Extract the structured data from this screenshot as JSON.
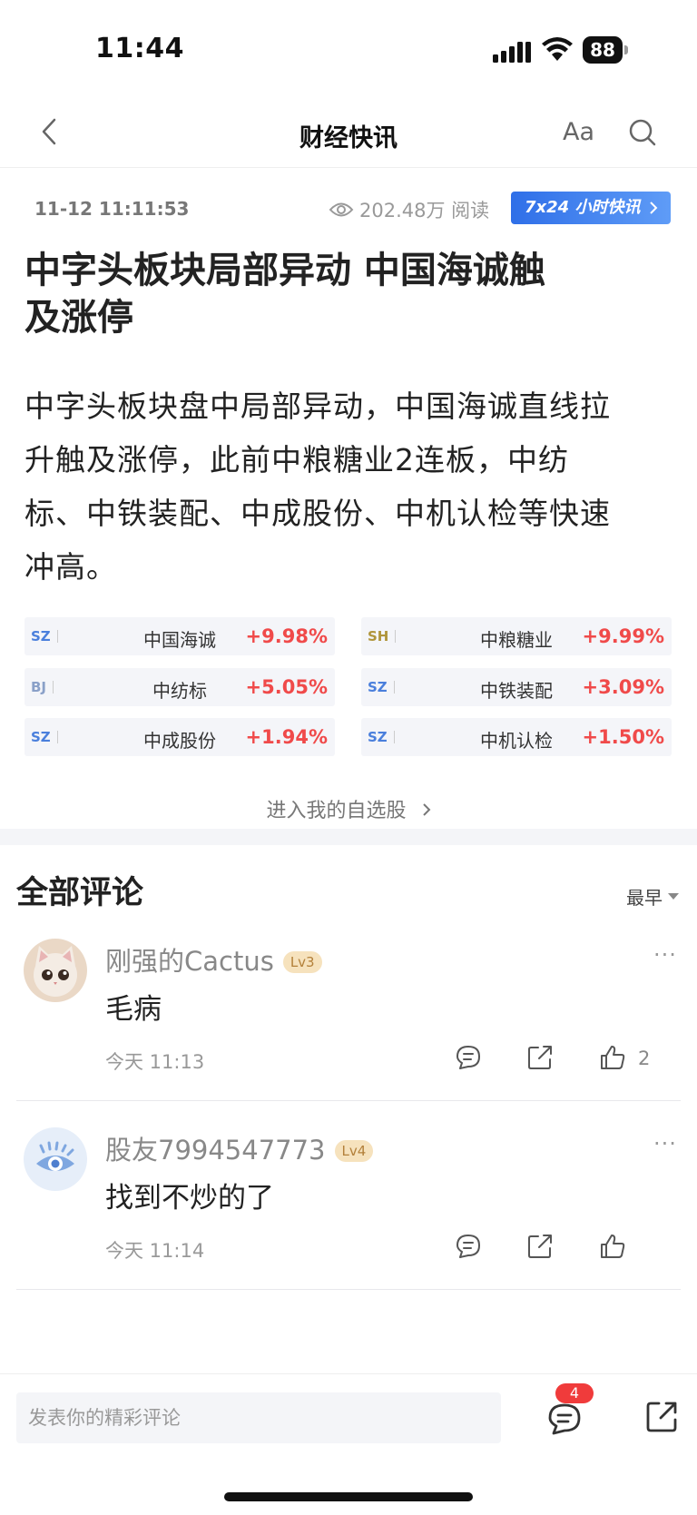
{
  "status_bar": {
    "time": "11:44",
    "battery": "88"
  },
  "nav": {
    "title": "财经快讯",
    "font_label": "Aa"
  },
  "article": {
    "datetime": "11-12 11:11:53",
    "views": "202.48万 阅读",
    "badge": "7x24 小时快讯",
    "headline_line1": "中字头板块局部异动 中国海诚触",
    "headline_line2": "及涨停",
    "body_lines": [
      "中字头板块盘中局部异动，中国海诚直线拉",
      "升触及涨停，此前中粮糖业2连板，中纺",
      "标、中铁装配、中成股份、中机认检等快速",
      "冲高。"
    ],
    "stocks": [
      {
        "exchange": "SZ",
        "name": "中国海诚",
        "change": "+9.98%"
      },
      {
        "exchange": "SH",
        "name": "中粮糖业",
        "change": "+9.99%"
      },
      {
        "exchange": "BJ",
        "name": "中纺标",
        "change": "+5.05%"
      },
      {
        "exchange": "SZ",
        "name": "中铁装配",
        "change": "+3.09%"
      },
      {
        "exchange": "SZ",
        "name": "中成股份",
        "change": "+1.94%"
      },
      {
        "exchange": "SZ",
        "name": "中机认检",
        "change": "+1.50%"
      }
    ],
    "watchlist_link": "进入我的自选股"
  },
  "comments_section": {
    "title": "全部评论",
    "sort": "最早",
    "items": [
      {
        "user": "刚强的Cactus",
        "level": "Lv3",
        "text": "毛病",
        "time": "今天 11:13",
        "likes": "2"
      },
      {
        "user": "股友7994547773",
        "level": "Lv4",
        "text": "找到不炒的了",
        "time": "今天 11:14",
        "likes": ""
      }
    ]
  },
  "bottom_bar": {
    "input_placeholder": "发表你的精彩评论",
    "comment_count": "4"
  },
  "icons": {
    "back": "chevron-left-icon",
    "search": "search-icon",
    "eye": "eye-icon",
    "reply": "comment-bubble-icon",
    "share": "share-icon",
    "like": "thumbs-up-icon"
  },
  "colors": {
    "accent": "#2f6fe8",
    "up": "#f04a4a",
    "badge_count": "#f03b3b"
  }
}
